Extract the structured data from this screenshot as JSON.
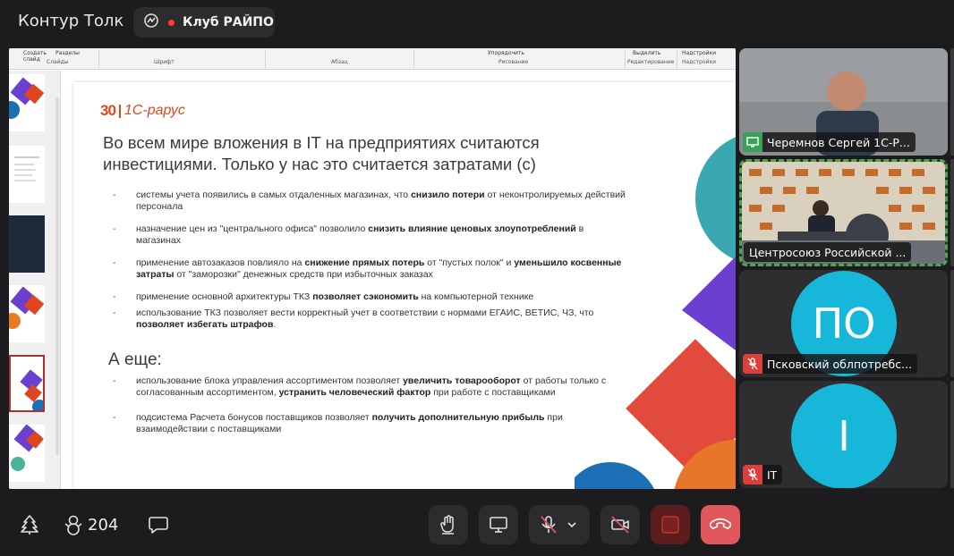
{
  "app": {
    "title": "Контур Толк",
    "room_name": "Клуб РАЙПО",
    "recording_color": "#ff3b30",
    "accent": "#17b7d9"
  },
  "ribbon": {
    "buttons": [
      "Создать слайд",
      "Разделы",
      "Упорядочить",
      "Выделить",
      "Надстройки"
    ],
    "groups": [
      "Слайды",
      "Шрифт",
      "Абзац",
      "Рисование",
      "Редактирование",
      "Надстройки"
    ]
  },
  "slide": {
    "logo_number": "30",
    "logo_brand": "1С-рарус",
    "title": "Во всем мире вложения в IT на предприятиях считаются инвестициями. Только у нас это считается затратами (с)",
    "bullets": [
      {
        "parts": [
          [
            "системы учета появились в самых отдаленных магазинах, что ",
            false
          ],
          [
            "снизило потери",
            true
          ],
          [
            " от неконтролируемых действий персонала",
            false
          ]
        ]
      },
      {
        "parts": [
          [
            "назначение цен из \"центрального офиса\" позволило ",
            false
          ],
          [
            "снизить влияние ценовых злоупотреблений",
            true
          ],
          [
            " в магазинах",
            false
          ]
        ]
      },
      {
        "parts": [
          [
            "применение автозаказов повлияло на ",
            false
          ],
          [
            "снижение прямых потерь",
            true
          ],
          [
            " от \"пустых полок\" и ",
            false
          ],
          [
            "уменьшило косвенные затраты",
            true
          ],
          [
            " от \"заморозки\" денежных средств при избыточных заказах",
            false
          ]
        ]
      },
      {
        "parts": [
          [
            "применение основной архитектуры ТКЗ ",
            false
          ],
          [
            "позволяет сэкономить",
            true
          ],
          [
            " на компьютерной технике",
            false
          ]
        ]
      },
      {
        "parts": [
          [
            "использование ТКЗ позволяет вести корректный учет в соответствии с нормами ЕГАИС, ВЕТИС, ЧЗ, что ",
            false
          ],
          [
            "позволяет избегать штрафов",
            true
          ],
          [
            ".",
            false
          ]
        ]
      }
    ],
    "subtitle": "А еще:",
    "bullets2": [
      {
        "parts": [
          [
            "использование блока управления ассортиментом позволяет ",
            false
          ],
          [
            "увеличить товарооборот",
            true
          ],
          [
            " от работы только с согласованным ассортиментом, ",
            false
          ],
          [
            "устранить человеческий фактор",
            true
          ],
          [
            " при работе с поставщиками",
            false
          ]
        ]
      },
      {
        "parts": [
          [
            "подсистема Расчета бонусов поставщиков позволяет ",
            false
          ],
          [
            "получить дополнительную прибыль",
            true
          ],
          [
            " при взаимодействии с поставщиками",
            false
          ]
        ]
      }
    ]
  },
  "participants": [
    {
      "name": "Черемнов Сергей 1С-Р...",
      "mic": "on"
    },
    {
      "name": "Центросоюз Российской ...",
      "mic": "none"
    },
    {
      "name": "Псковский облпотребс...",
      "initials": "ПО",
      "mic": "muted"
    },
    {
      "name": "IT",
      "initials": "I",
      "mic": "muted"
    }
  ],
  "toolbar": {
    "participant_count": "204",
    "end_call_color": "#e0575b",
    "stop_share_color": "#6e1c1c"
  }
}
